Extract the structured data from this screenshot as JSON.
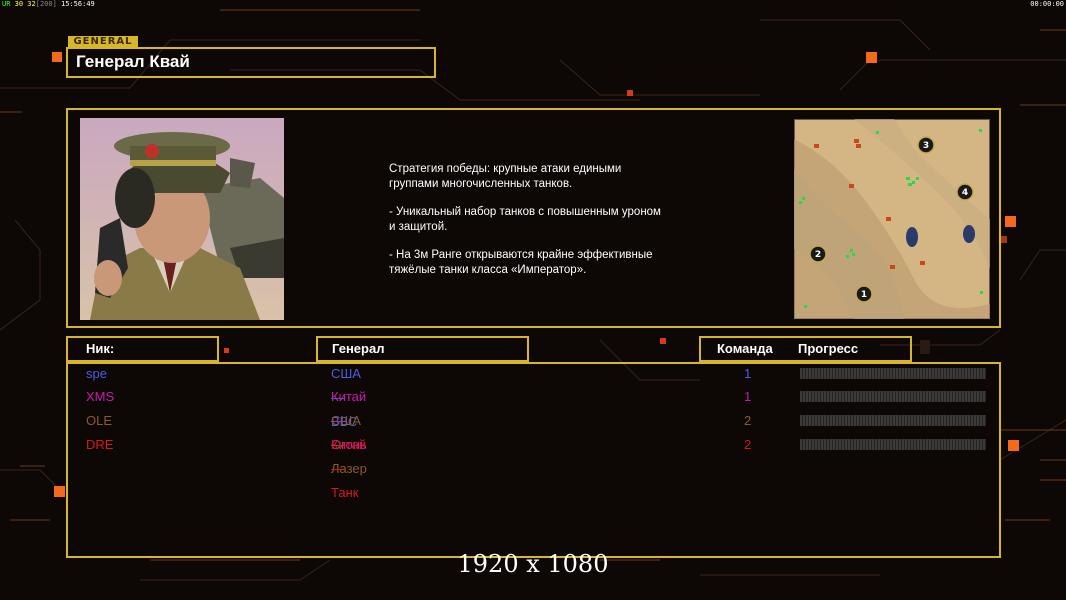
{
  "topbar": {
    "left_code": "UR",
    "left_nums": "30 32",
    "left_bracket": "[200]",
    "left_time": "15:56:49",
    "right_time": "00:00:00"
  },
  "general": {
    "tag": "GENERAL",
    "name": "Генерал Квай",
    "description": [
      "Стратегия победы: крупные атаки едиными\n группами многочисленных танков.",
      "- Уникальный набор танков с повышенным уроном\n и защитой.",
      "- На 3м Ранге открываются крайне эффективные\n тяжёлые танки класса «Император»."
    ]
  },
  "map": {
    "spawns": [
      "1",
      "2",
      "3",
      "4"
    ]
  },
  "table": {
    "headers": {
      "nick": "Ник:",
      "general": "Генерал",
      "team": "Команда",
      "progress": "Прогресс"
    },
    "players": [
      {
        "nick": "spe",
        "general": "США — ВВС",
        "team": "1",
        "color": "#4b5de6"
      },
      {
        "nick": "XMS",
        "general": "Китай — Огонь",
        "team": "1",
        "color": "#c71cb0"
      },
      {
        "nick": "OLE",
        "general": "США — Лазер",
        "team": "2",
        "color": "#8a5a32"
      },
      {
        "nick": "DRE",
        "general": "Китай — Танк",
        "team": "2",
        "color": "#d71a1a"
      }
    ]
  },
  "colors": {
    "frame": "#d7b629",
    "accent": "#f56a1a"
  },
  "footer": "1920 x 1080"
}
